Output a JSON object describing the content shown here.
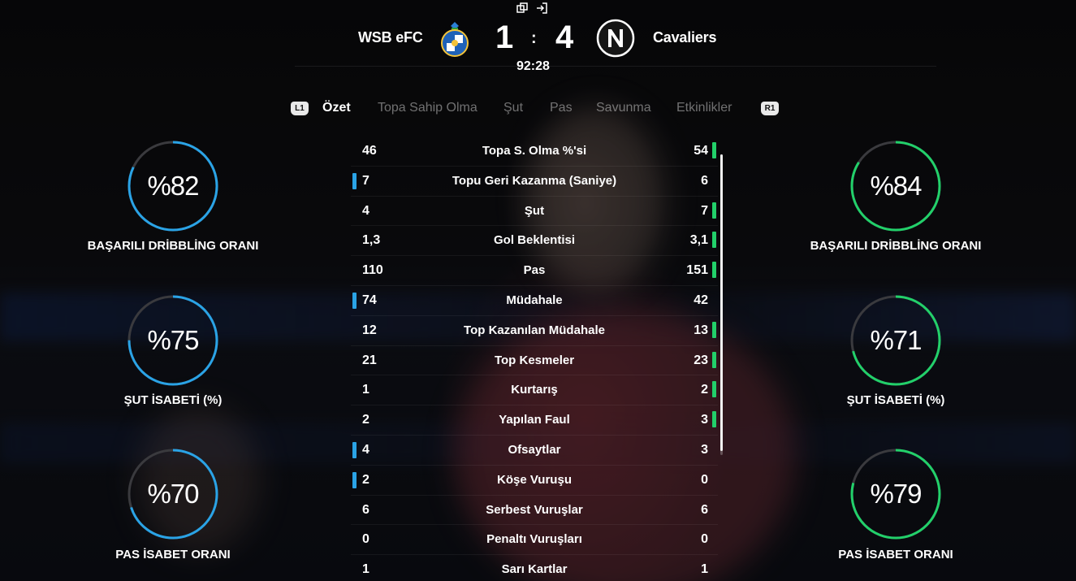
{
  "header": {
    "home_team": "WSB eFC",
    "away_team": "Cavaliers",
    "home_score": "1",
    "separator": ":",
    "away_score": "4",
    "clock": "92:28",
    "home_crest_icon": "fc-porto-crest-icon",
    "away_crest_icon": "napoli-n-crest-icon",
    "top_icons": [
      "window-restore-icon",
      "sign-in-icon"
    ]
  },
  "tabs": {
    "left_button": "L1",
    "right_button": "R1",
    "items": [
      {
        "label": "Özet",
        "active": true
      },
      {
        "label": "Topa Sahip Olma",
        "active": false
      },
      {
        "label": "Şut",
        "active": false
      },
      {
        "label": "Pas",
        "active": false
      },
      {
        "label": "Savunma",
        "active": false
      },
      {
        "label": "Etkinlikler",
        "active": false
      }
    ]
  },
  "colors": {
    "home_accent": "#2aa3e6",
    "away_accent": "#22d06a",
    "ring_track": "#3a3a3e"
  },
  "home_rings": [
    {
      "value": "%82",
      "percent": 82,
      "label": "BAŞARILI DRİBBLİNG ORANI"
    },
    {
      "value": "%75",
      "percent": 75,
      "label": "ŞUT İSABETİ (%)"
    },
    {
      "value": "%70",
      "percent": 70,
      "label": "PAS İSABET ORANI"
    }
  ],
  "away_rings": [
    {
      "value": "%84",
      "percent": 84,
      "label": "BAŞARILI DRİBBLİNG ORANI"
    },
    {
      "value": "%71",
      "percent": 71,
      "label": "ŞUT İSABETİ (%)"
    },
    {
      "value": "%79",
      "percent": 79,
      "label": "PAS İSABET ORANI"
    }
  ],
  "stats": [
    {
      "home": "46",
      "name": "Topa S. Olma %'si",
      "away": "54",
      "leader": "away"
    },
    {
      "home": "7",
      "name": "Topu Geri Kazanma (Saniye)",
      "away": "6",
      "leader": "home"
    },
    {
      "home": "4",
      "name": "Şut",
      "away": "7",
      "leader": "away"
    },
    {
      "home": "1,3",
      "name": "Gol Beklentisi",
      "away": "3,1",
      "leader": "away"
    },
    {
      "home": "110",
      "name": "Pas",
      "away": "151",
      "leader": "away"
    },
    {
      "home": "74",
      "name": "Müdahale",
      "away": "42",
      "leader": "home"
    },
    {
      "home": "12",
      "name": "Top Kazanılan Müdahale",
      "away": "13",
      "leader": "away"
    },
    {
      "home": "21",
      "name": "Top Kesmeler",
      "away": "23",
      "leader": "away"
    },
    {
      "home": "1",
      "name": "Kurtarış",
      "away": "2",
      "leader": "away"
    },
    {
      "home": "2",
      "name": "Yapılan Faul",
      "away": "3",
      "leader": "away"
    },
    {
      "home": "4",
      "name": "Ofsaytlar",
      "away": "3",
      "leader": "home"
    },
    {
      "home": "2",
      "name": "Köşe Vuruşu",
      "away": "0",
      "leader": "home"
    },
    {
      "home": "6",
      "name": "Serbest Vuruşlar",
      "away": "6",
      "leader": "none"
    },
    {
      "home": "0",
      "name": "Penaltı Vuruşları",
      "away": "0",
      "leader": "none"
    },
    {
      "home": "1",
      "name": "Sarı Kartlar",
      "away": "1",
      "leader": "none"
    }
  ]
}
